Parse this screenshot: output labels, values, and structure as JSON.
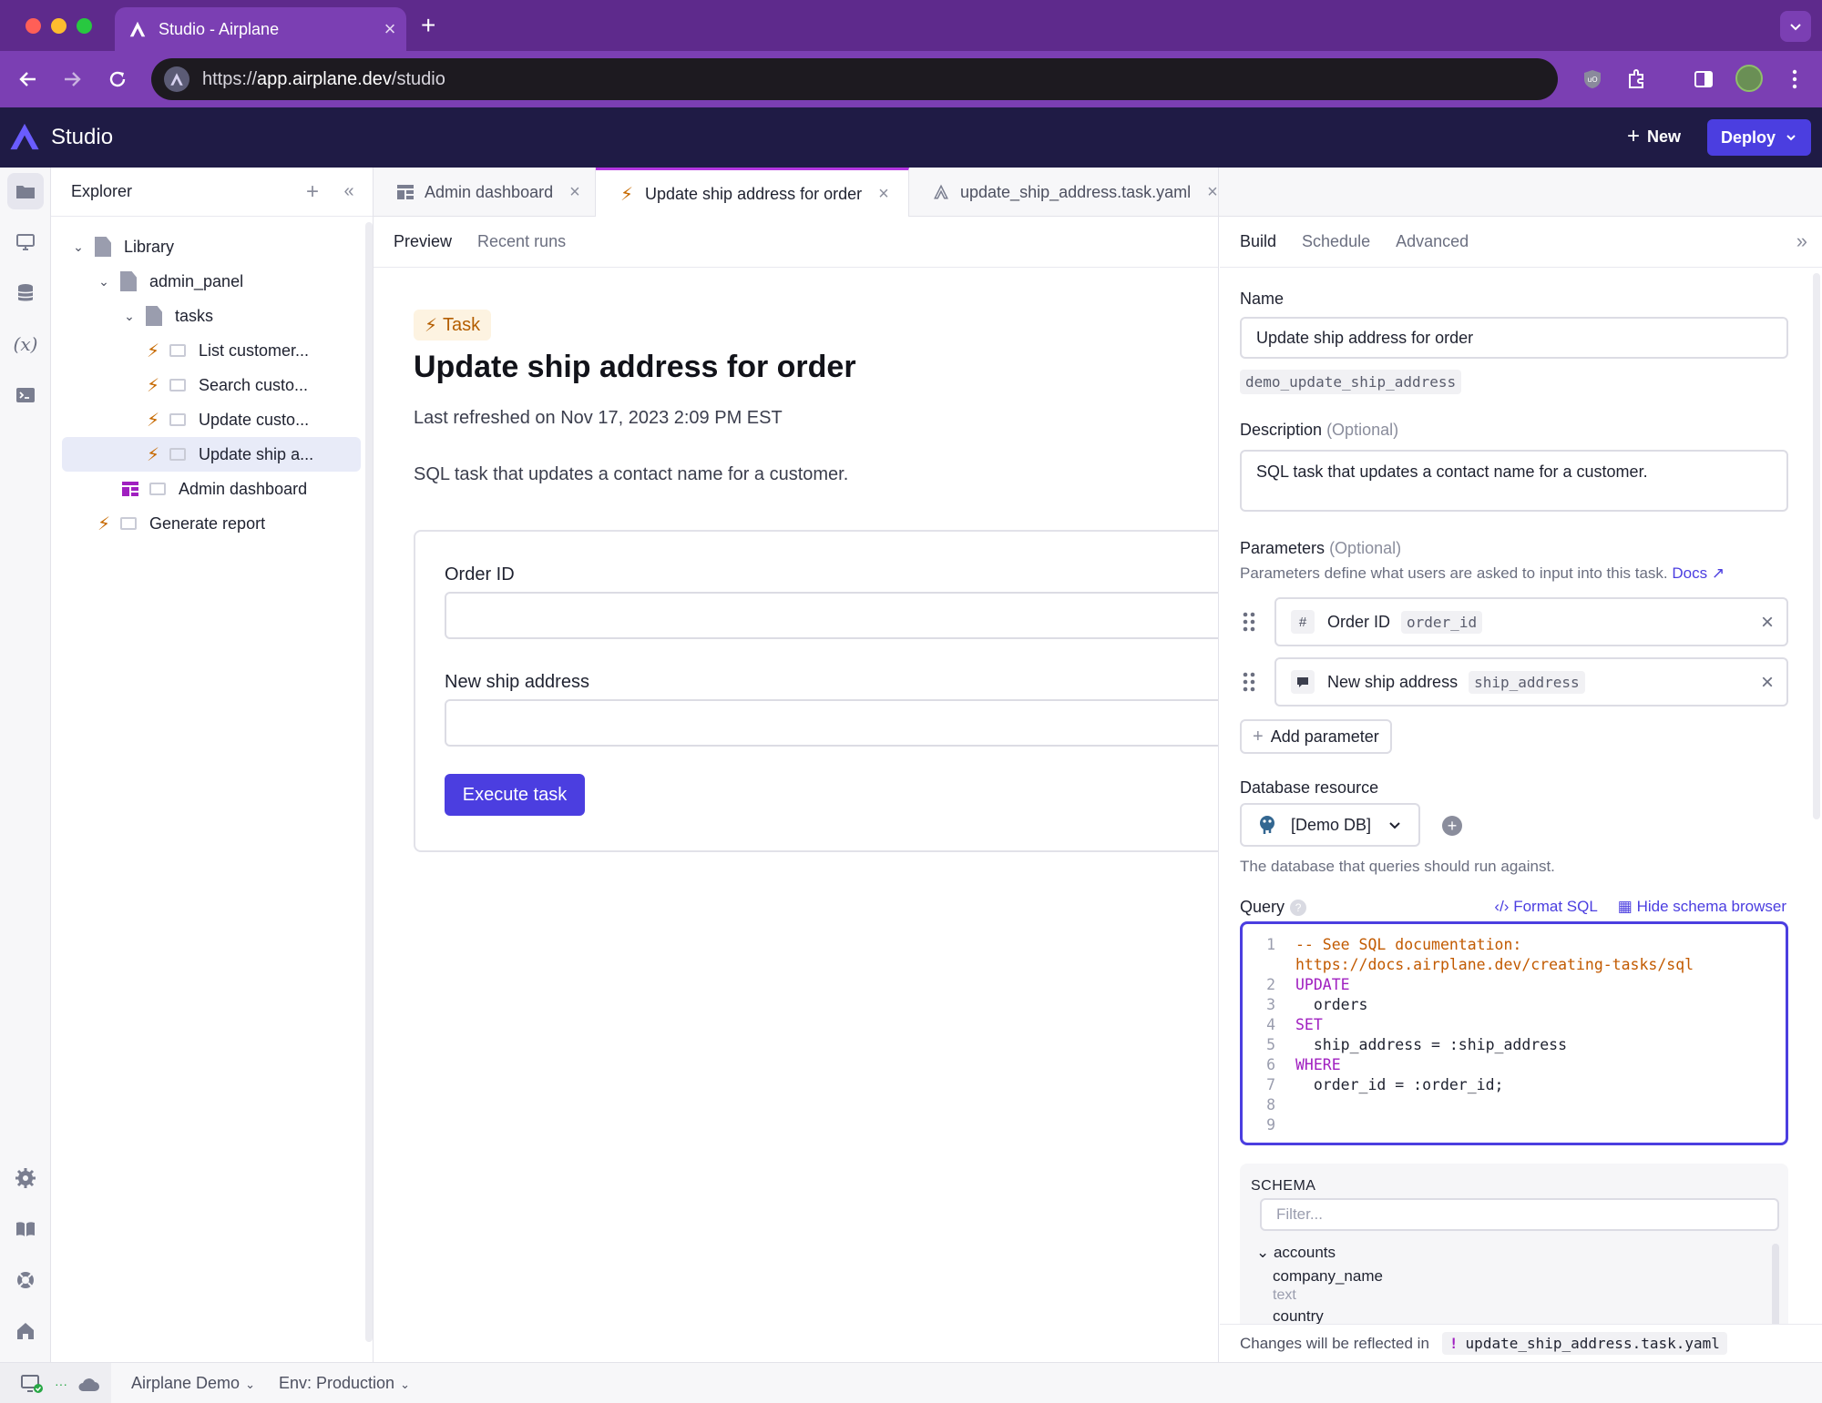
{
  "browser": {
    "tab_title": "Studio - Airplane",
    "url_scheme": "https://",
    "url_host": "app.airplane.dev",
    "url_path": "/studio"
  },
  "app": {
    "title": "Studio",
    "new_label": "New",
    "deploy_label": "Deploy"
  },
  "explorer": {
    "title": "Explorer",
    "tree": [
      {
        "label": "Library"
      },
      {
        "label": "admin_panel"
      },
      {
        "label": "tasks"
      },
      {
        "label": "List customer..."
      },
      {
        "label": "Search custo..."
      },
      {
        "label": "Update custo..."
      },
      {
        "label": "Update ship a..."
      },
      {
        "label": "Admin dashboard"
      },
      {
        "label": "Generate report"
      }
    ]
  },
  "editor_tabs": [
    {
      "label": "Admin dashboard"
    },
    {
      "label": "Update ship address for order"
    },
    {
      "label": "update_ship_address.task.yaml"
    }
  ],
  "preview": {
    "subtabs": [
      "Preview",
      "Recent runs"
    ],
    "badge": "Task",
    "title": "Update ship address for order",
    "refreshed": "Last refreshed on Nov 17, 2023 2:09 PM EST",
    "description": "SQL task that updates a contact name for a customer.",
    "fields": [
      {
        "label": "Order ID",
        "value": ""
      },
      {
        "label": "New ship address",
        "value": ""
      }
    ],
    "execute_label": "Execute task"
  },
  "panel": {
    "tabs": [
      "Build",
      "Schedule",
      "Advanced"
    ],
    "name_label": "Name",
    "name_value": "Update ship address for order",
    "slug": "demo_update_ship_address",
    "description_label": "Description",
    "optional": "(Optional)",
    "description_value": "SQL task that updates a contact name for a customer.",
    "parameters_label": "Parameters",
    "parameters_help": "Parameters define what users are asked to input into this task.",
    "docs_link": "Docs",
    "parameters": [
      {
        "type_icon": "#",
        "name": "Order ID",
        "slug": "order_id"
      },
      {
        "type_icon": "text-bubble-icon",
        "name": "New ship address",
        "slug": "ship_address"
      }
    ],
    "add_parameter": "Add parameter",
    "db_label": "Database resource",
    "db_value": "[Demo DB]",
    "db_help": "The database that queries should run against.",
    "query_label": "Query",
    "format_sql": "Format SQL",
    "hide_schema": "Hide schema browser",
    "query_lines": [
      {
        "n": "1",
        "parts": [
          {
            "t": "c",
            "s": "-- See SQL documentation:"
          }
        ]
      },
      {
        "n": "",
        "parts": [
          {
            "t": "c",
            "s": "https://docs.airplane.dev/creating-tasks/sql"
          }
        ]
      },
      {
        "n": "2",
        "parts": [
          {
            "t": "k",
            "s": "UPDATE"
          }
        ]
      },
      {
        "n": "3",
        "parts": [
          {
            "t": "p",
            "s": "  orders"
          }
        ]
      },
      {
        "n": "4",
        "parts": [
          {
            "t": "k",
            "s": "SET"
          }
        ]
      },
      {
        "n": "5",
        "parts": [
          {
            "t": "p",
            "s": "  ship_address = :ship_address"
          }
        ]
      },
      {
        "n": "6",
        "parts": [
          {
            "t": "k",
            "s": "WHERE"
          }
        ]
      },
      {
        "n": "7",
        "parts": [
          {
            "t": "p",
            "s": "  order_id = :order_id;"
          }
        ]
      },
      {
        "n": "8",
        "parts": []
      },
      {
        "n": "9",
        "parts": []
      }
    ],
    "schema_title": "SCHEMA",
    "schema_filter_placeholder": "Filter...",
    "schema_table": "accounts",
    "schema_columns": [
      {
        "name": "company_name",
        "type": "text"
      },
      {
        "name": "country",
        "type": ""
      }
    ],
    "footer_text": "Changes will be reflected in",
    "footer_file": "update_ship_address.task.yaml"
  },
  "statusbar": {
    "workspace": "Airplane Demo",
    "env": "Env: Production"
  },
  "colors": {
    "accent": "#4b3ee0",
    "task_orange": "#c76a00",
    "browser_purple": "#7b3fb3",
    "header_navy": "#1f1b45"
  }
}
